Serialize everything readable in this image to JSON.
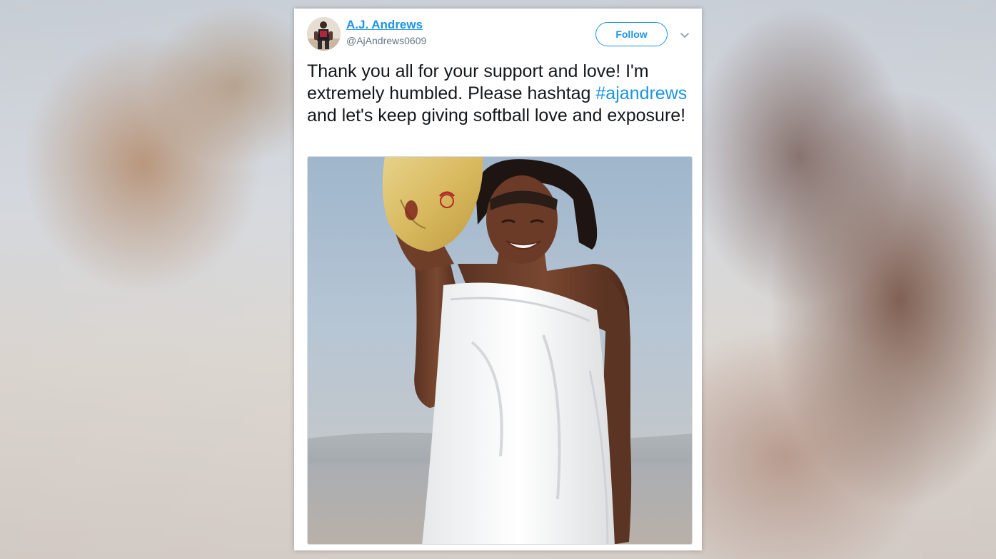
{
  "tweet": {
    "author_name": "A.J. Andrews",
    "author_handle": "@AjAndrews0609",
    "follow_label": "Follow",
    "text_before": "Thank you all for your support and love! I'm extremely humbled. Please hashtag ",
    "hashtag": "#ajandrews",
    "text_after": " and let's keep giving softball love and exposure!"
  },
  "icons": {
    "menu": "chevron-down-icon"
  },
  "colors": {
    "link": "#1b95e0",
    "text": "#14171a",
    "muted": "#657786"
  }
}
